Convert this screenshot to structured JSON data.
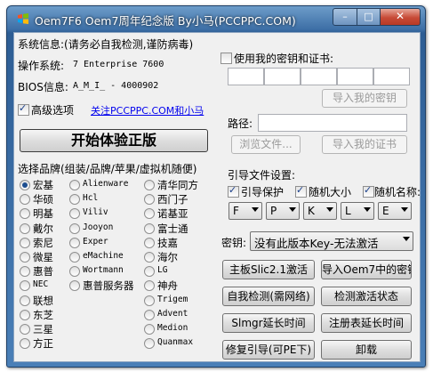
{
  "window": {
    "title": "Oem7F6 Oem7周年纪念版    By小马(PCCPPC.COM)",
    "controls": {
      "minimize": "–",
      "maximize": "□",
      "close": "✕"
    }
  },
  "sysinfo": {
    "header": "系统信息:(请务必自我检测,谨防病毒)",
    "os_label": "操作系统:",
    "os_value": "7 Enterprise 7600",
    "bios_label": "BIOS信息:",
    "bios_value": "A_M_I_ - 4000902",
    "advanced_label": "高级选项",
    "about_link": "关注PCCPPC.COM和小马"
  },
  "start_button": "开始体验正版",
  "brands": {
    "header": "选择品牌(组装/品牌/苹果/虚拟机随便)",
    "col1": [
      "宏基",
      "华硕",
      "明基",
      "戴尔",
      "索尼",
      "微星",
      "惠普",
      "NEC",
      "联想",
      "东芝",
      "三星",
      "方正"
    ],
    "col2": [
      "Alienware",
      "Hcl",
      "Viliv",
      "Jooyon",
      "Exper",
      "eMachine",
      "Wortmann",
      "惠普服务器"
    ],
    "col3": [
      "清华同方",
      "西门子",
      "诺基亚",
      "富士通",
      "技嘉",
      "海尔",
      "LG",
      "神舟",
      "Trigem",
      "Advent",
      "Medion",
      "Quanmax"
    ]
  },
  "key": {
    "use_own_label": "使用我的密钥和证书:",
    "import_key_button": "导入我的密钥",
    "path_label": "路径:",
    "browse_button": "浏览文件...",
    "import_cert_button": "导入我的证书"
  },
  "boot": {
    "header": "引导文件设置:",
    "protect_label": "引导保护",
    "random_size_label": "随机大小",
    "random_name_label": "随机名称:",
    "drives": [
      "F",
      "P",
      "K",
      "L",
      "E"
    ],
    "key_label": "密钥:",
    "key_value": "没有此版本Key-无法激活"
  },
  "actions": {
    "mainboard": "主板Slic2.1激活",
    "import_oem7": "导入Oem7中的密钥",
    "self_check": "自我检测(需网络)",
    "check_status": "检测激活状态",
    "slmgr": "Slmgr延长时间",
    "registry": "注册表延长时间",
    "repair_boot": "修复引导(可PE下)",
    "uninstall": "卸载"
  }
}
